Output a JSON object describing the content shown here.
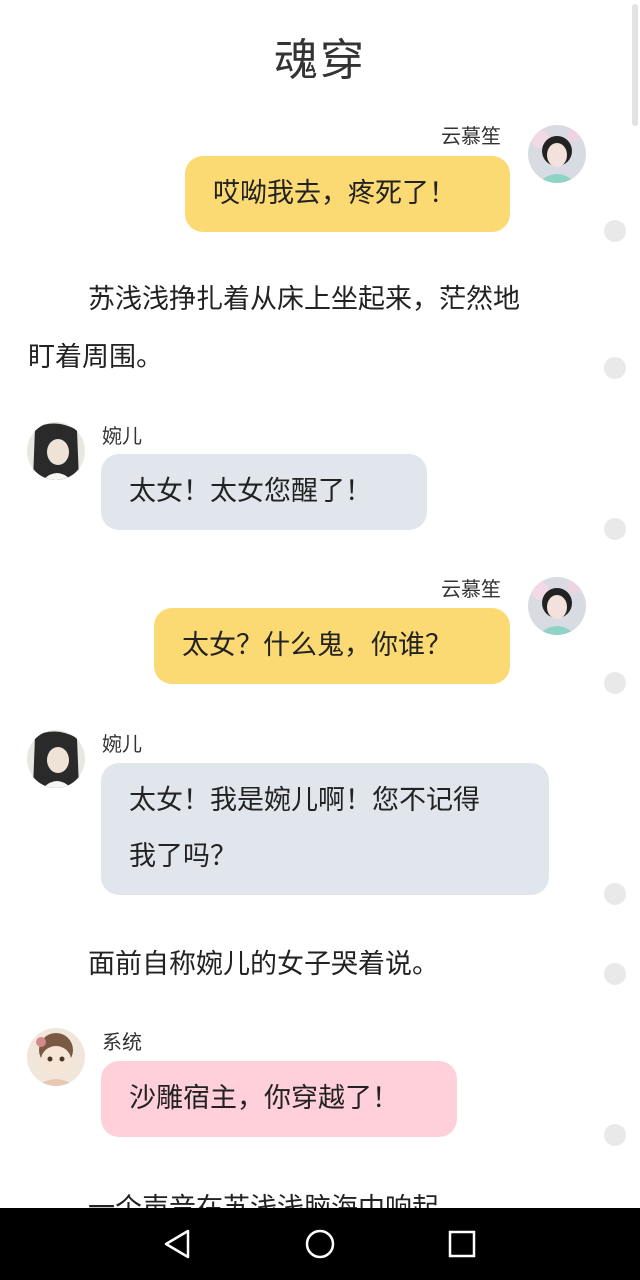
{
  "title": "魂穿",
  "messages": [
    {
      "speaker": "云慕笙",
      "text": "哎呦我去，疼死了！",
      "side": "right"
    },
    {
      "narration_1": "苏浅浅挣扎着从床上坐起来，茫然地",
      "narration_2": "盯着周围。"
    },
    {
      "speaker": "婉儿",
      "text": "太女！太女您醒了！",
      "side": "left"
    },
    {
      "speaker": "云慕笙",
      "text": "太女？什么鬼，你谁？",
      "side": "right"
    },
    {
      "speaker": "婉儿",
      "text_1": "太女！我是婉儿啊！您不记得",
      "text_2": "我了吗？",
      "side": "left"
    },
    {
      "narration": "面前自称婉儿的女子哭着说。"
    },
    {
      "speaker": "系统",
      "text": "沙雕宿主，你穿越了！",
      "side": "left"
    },
    {
      "narration": "一个声音在苏浅浅脑海中响起"
    }
  ],
  "colors": {
    "yellow_bubble": "#fbda74",
    "gray_bubble": "#e1e6ed",
    "pink_bubble": "#ffd0d9",
    "navbar": "#000000"
  },
  "navbar": {
    "back_icon": "back-triangle-icon",
    "home_icon": "home-circle-icon",
    "recents_icon": "recents-square-icon"
  }
}
